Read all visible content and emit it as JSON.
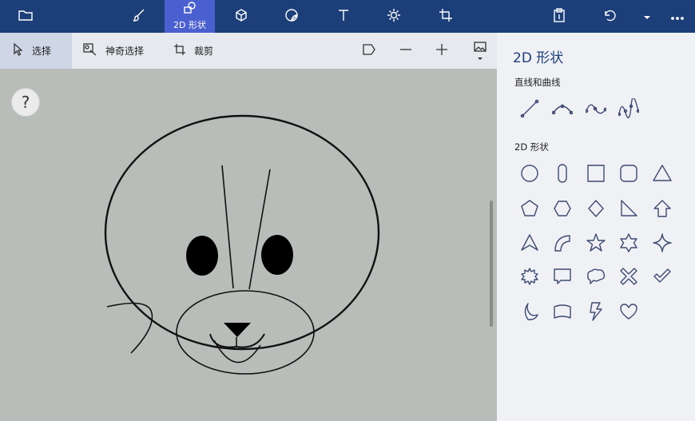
{
  "toolbar": {
    "active_tab_label": "2D 形状",
    "icons": [
      "folder-icon",
      "brush-icon",
      "shapes-2d-icon",
      "cube-icon",
      "sticker-icon",
      "text-icon",
      "effects-icon",
      "crop-canvas-icon",
      "paste-icon",
      "undo-icon",
      "history-dropdown-icon",
      "more-icon"
    ]
  },
  "subbar": {
    "select_label": "选择",
    "magic_select_label": "神奇选择",
    "crop_label": "裁剪"
  },
  "canvas": {
    "help_label": "?"
  },
  "panel": {
    "title": "2D 形状",
    "lines_section": "直线和曲线",
    "shapes_section": "2D 形状"
  }
}
